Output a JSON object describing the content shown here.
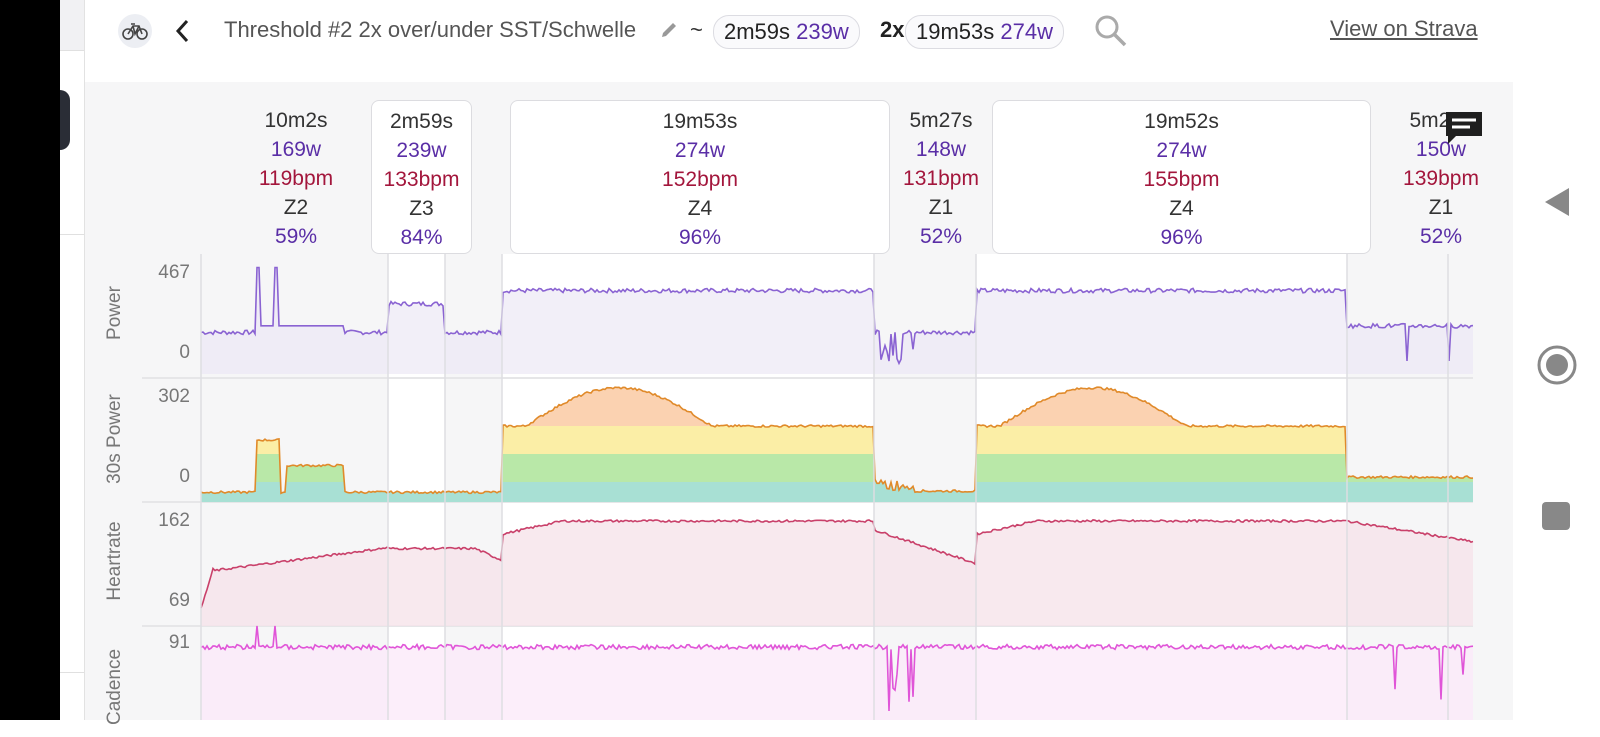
{
  "header": {
    "title": "Threshold #2 2x over/under SST/Schwelle",
    "tilde": "~",
    "pill1": {
      "dur": "2m59s",
      "watts": "239w"
    },
    "multiplier": "2x",
    "pill2": {
      "dur": "19m53s",
      "watts": "274w"
    },
    "strava_link": "View on Strava"
  },
  "intervals": [
    {
      "dur": "10m2s",
      "watts": "169w",
      "bpm": "119bpm",
      "zone": "Z2",
      "pct": "59%"
    },
    {
      "dur": "2m59s",
      "watts": "239w",
      "bpm": "133bpm",
      "zone": "Z3",
      "pct": "84%"
    },
    {
      "dur": "19m53s",
      "watts": "274w",
      "bpm": "152bpm",
      "zone": "Z4",
      "pct": "96%"
    },
    {
      "dur": "5m27s",
      "watts": "148w",
      "bpm": "131bpm",
      "zone": "Z1",
      "pct": "52%"
    },
    {
      "dur": "19m52s",
      "watts": "274w",
      "bpm": "155bpm",
      "zone": "Z4",
      "pct": "96%"
    },
    {
      "dur": "5m26s",
      "watts": "150w",
      "bpm": "139bpm",
      "zone": "Z1",
      "pct": "52%"
    }
  ],
  "panels": {
    "power": {
      "label": "Power",
      "max": "467",
      "min": "0"
    },
    "power30": {
      "label": "30s Power",
      "max": "302",
      "min": "0"
    },
    "heartrate": {
      "label": "Heartrate",
      "max": "162",
      "min": "69"
    },
    "cadence": {
      "label": "Cadence",
      "max": "91"
    }
  },
  "colors": {
    "power": "#8a63d2",
    "heartrate": "#c9406a",
    "cadence": "#e055d8",
    "accent": "#5a2ea6",
    "bpm": "#a3163c"
  },
  "icons": {
    "bike": "bicycle-icon",
    "back": "chevron-left-icon",
    "edit": "pencil-icon",
    "search": "search-icon",
    "comment": "comment-icon"
  }
}
